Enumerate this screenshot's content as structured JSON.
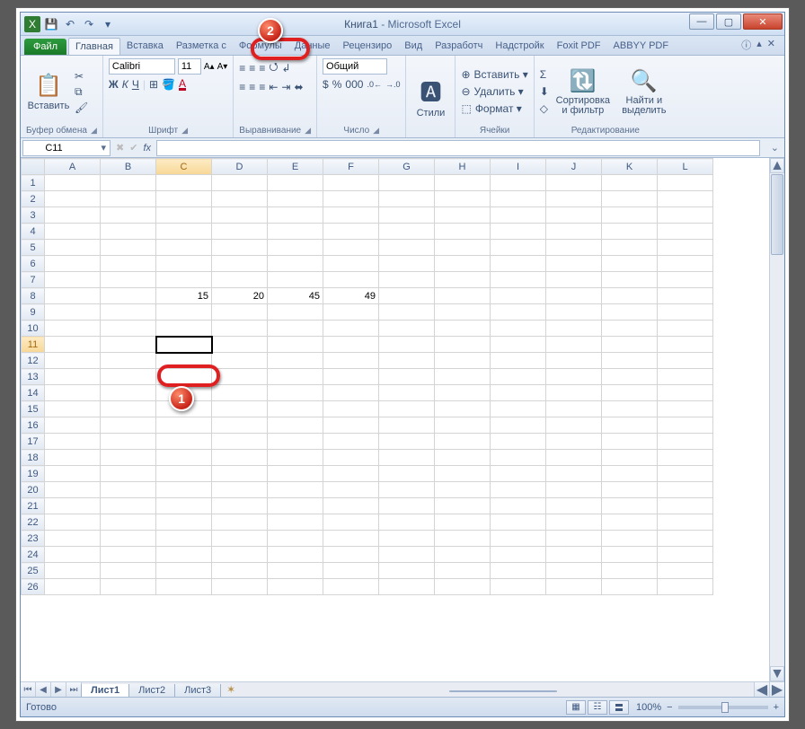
{
  "title": {
    "book": "Книга1",
    "app": "Microsoft Excel"
  },
  "win_buttons": {
    "min": "—",
    "max": "▢",
    "close": "✕"
  },
  "qat": {
    "excel_icon": "X",
    "save": "💾",
    "undo": "↶",
    "redo": "↷",
    "menu": "▾"
  },
  "tabs": {
    "file": "Файл",
    "items": [
      "Главная",
      "Вставка",
      "Разметка с",
      "Формулы",
      "Данные",
      "Рецензиро",
      "Вид",
      "Разработч",
      "Надстройк",
      "Foxit PDF",
      "ABBYY PDF"
    ],
    "active_index": 0,
    "help": "ⓘ",
    "min_ribbon": "▴",
    "doc_close": "✕"
  },
  "ribbon": {
    "clipboard": {
      "paste": "Вставить",
      "cut": "✂",
      "copy": "⧉",
      "painter": "🖌",
      "label": "Буфер обмена"
    },
    "font": {
      "name": "Calibri",
      "size": "11",
      "bold": "Ж",
      "italic": "К",
      "underline": "Ч",
      "border": "⊞",
      "fill": "🪣",
      "color": "A",
      "grow": "A▴",
      "shrink": "A▾",
      "label": "Шрифт"
    },
    "alignment": {
      "top": "⬆",
      "mid": "⇔",
      "bot": "⬇",
      "left": "≡",
      "center": "≡",
      "right": "≡",
      "wrap": "↲",
      "merge": "⬌",
      "indent_dec": "⇤",
      "indent_inc": "⇥",
      "label": "Выравнивание"
    },
    "number": {
      "format": "Общий",
      "currency": "$",
      "percent": "%",
      "comma": "000",
      "inc": ".0←",
      "dec": "→.0",
      "label": "Число"
    },
    "styles": {
      "styles_btn": "Стили",
      "label": ""
    },
    "cells": {
      "insert": "Вставить ▾",
      "delete": "Удалить ▾",
      "format": "Формат ▾",
      "ins_ico": "⊕",
      "del_ico": "⊖",
      "fmt_ico": "⬚",
      "label": "Ячейки"
    },
    "editing": {
      "sum": "Σ",
      "fill": "⬇",
      "clear": "◇",
      "sort": "Сортировка и фильтр",
      "find": "Найти и выделить",
      "label": "Редактирование"
    }
  },
  "formula_bar": {
    "name_box": "C11",
    "fx": "fx",
    "formula": ""
  },
  "columns": [
    "A",
    "B",
    "C",
    "D",
    "E",
    "F",
    "G",
    "H",
    "I",
    "J",
    "K",
    "L"
  ],
  "rows": 26,
  "active_cell": {
    "col": "C",
    "row": 11
  },
  "cells": {
    "C8": "15",
    "D8": "20",
    "E8": "45",
    "F8": "49"
  },
  "sheets": {
    "items": [
      "Лист1",
      "Лист2",
      "Лист3"
    ],
    "active_index": 0,
    "nav": [
      "⏮",
      "◀",
      "▶",
      "⏭"
    ],
    "new": "✶"
  },
  "status": {
    "ready": "Готово",
    "zoom": "100%",
    "zoom_minus": "−",
    "zoom_plus": "+"
  },
  "markers": {
    "m1": "1",
    "m2": "2"
  }
}
